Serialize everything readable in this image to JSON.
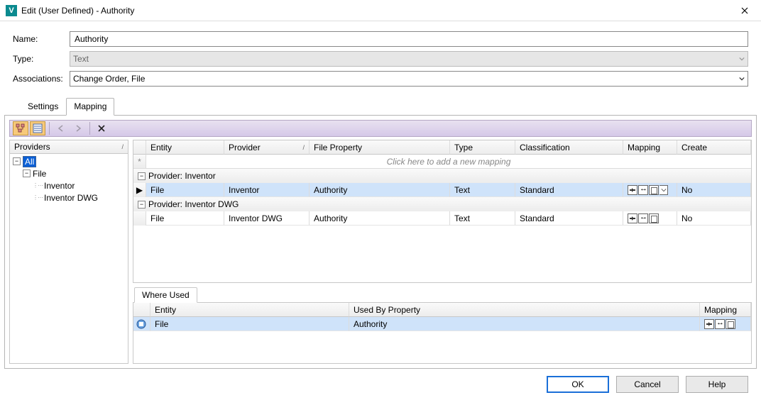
{
  "window": {
    "icon_letter": "V",
    "title": "Edit (User Defined) - Authority"
  },
  "form": {
    "name_label": "Name:",
    "name_value": "Authority",
    "type_label": "Type:",
    "type_value": "Text",
    "assoc_label": "Associations:",
    "assoc_value": "Change Order, File"
  },
  "tabs": {
    "settings": "Settings",
    "mapping": "Mapping"
  },
  "providers": {
    "header": "Providers",
    "root": "All",
    "file": "File",
    "inventor": "Inventor",
    "inventor_dwg": "Inventor DWG"
  },
  "grid": {
    "h_entity": "Entity",
    "h_provider": "Provider",
    "h_fileprop": "File Property",
    "h_type": "Type",
    "h_class": "Classification",
    "h_mapping": "Mapping",
    "h_create": "Create",
    "add_hint": "Click here to add a new mapping",
    "group1": "Provider: Inventor",
    "group2": "Provider: Inventor DWG",
    "rows": [
      {
        "entity": "File",
        "provider": "Inventor",
        "fileprop": "Authority",
        "type": "Text",
        "class": "Standard",
        "create": "No"
      },
      {
        "entity": "File",
        "provider": "Inventor DWG",
        "fileprop": "Authority",
        "type": "Text",
        "class": "Standard",
        "create": "No"
      }
    ]
  },
  "where": {
    "tab": "Where Used",
    "h_entity": "Entity",
    "h_used": "Used By Property",
    "h_mapping": "Mapping",
    "row": {
      "entity": "File",
      "used": "Authority"
    }
  },
  "buttons": {
    "ok": "OK",
    "cancel": "Cancel",
    "help": "Help"
  }
}
